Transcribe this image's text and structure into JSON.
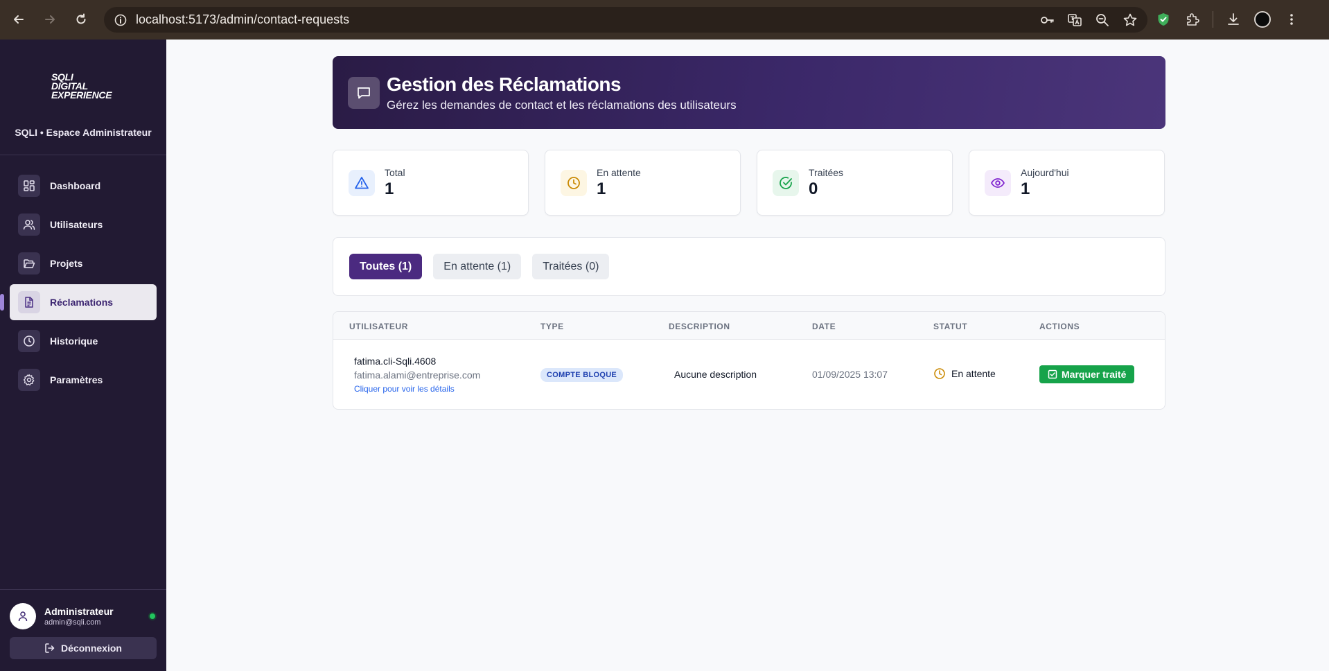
{
  "browser": {
    "url": "localhost:5173/admin/contact-requests"
  },
  "sidebar": {
    "logo_lines": [
      "SQLI",
      "DIGITAL",
      "EXPERIENCE"
    ],
    "subtitle": "SQLI • Espace Administrateur",
    "items": [
      {
        "label": "Dashboard",
        "icon": "dashboard-icon"
      },
      {
        "label": "Utilisateurs",
        "icon": "users-icon"
      },
      {
        "label": "Projets",
        "icon": "folder-icon"
      },
      {
        "label": "Réclamations",
        "icon": "document-icon",
        "active": true
      },
      {
        "label": "Historique",
        "icon": "clock-icon"
      },
      {
        "label": "Paramètres",
        "icon": "gear-icon"
      }
    ],
    "user": {
      "name": "Administrateur",
      "email": "admin@sqli.com"
    },
    "logout_label": "Déconnexion"
  },
  "header": {
    "title": "Gestion des Réclamations",
    "subtitle": "Gérez les demandes de contact et les réclamations des utilisateurs"
  },
  "stats": [
    {
      "label": "Total",
      "value": "1",
      "icon": "alert-triangle-icon",
      "color": "#2563eb",
      "bg": "#e8f0fd"
    },
    {
      "label": "En attente",
      "value": "1",
      "icon": "clock-icon",
      "color": "#ca8a04",
      "bg": "#fdf6e3"
    },
    {
      "label": "Traitées",
      "value": "0",
      "icon": "check-circle-icon",
      "color": "#16a34a",
      "bg": "#e7f6ec"
    },
    {
      "label": "Aujourd'hui",
      "value": "1",
      "icon": "eye-icon",
      "color": "#7e22ce",
      "bg": "#f4ebfb"
    }
  ],
  "tabs": [
    {
      "label": "Toutes (1)",
      "active": true
    },
    {
      "label": "En attente (1)",
      "active": false
    },
    {
      "label": "Traitées (0)",
      "active": false
    }
  ],
  "table": {
    "columns": [
      "UTILISATEUR",
      "TYPE",
      "DESCRIPTION",
      "DATE",
      "STATUT",
      "ACTIONS"
    ],
    "rows": [
      {
        "username": "fatima.cli-Sqli.4608",
        "email": "fatima.alami@entreprise.com",
        "details_link": "Cliquer pour voir les détails",
        "type": "COMPTE BLOQUE",
        "description": "Aucune description",
        "date": "01/09/2025 13:07",
        "status": "En attente",
        "action": "Marquer traité"
      }
    ]
  },
  "colors": {
    "sidebar_bg": "#221a33",
    "accent": "#4b2a80",
    "success": "#16a34a"
  }
}
